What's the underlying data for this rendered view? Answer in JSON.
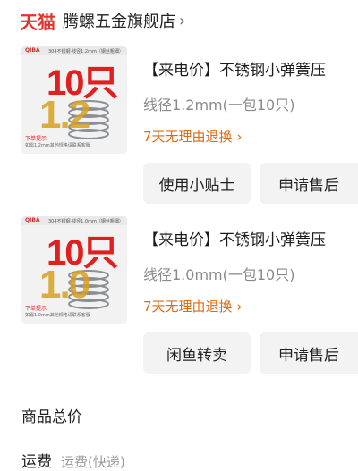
{
  "shop": {
    "logo": "天猫",
    "name": "腾螺五金旗舰店",
    "chevron": "›"
  },
  "orders": [
    {
      "thumb": {
        "brand": "QIBA",
        "spec": "304不锈钢·线径1.2mm（钢丝粗细）",
        "count": "10只",
        "size": "1.2",
        "tag": "下单提示",
        "tiny": "如需1.2mm其他规格请联系客服"
      },
      "title": "【来电价】不锈钢小弹簧压",
      "spec": "线径1.2mm(一包10只)",
      "returns": "7天无理由退换",
      "buttons": [
        "使用小贴士",
        "申请售后"
      ]
    },
    {
      "thumb": {
        "brand": "QIBA",
        "spec": "304不锈钢·线径1.0mm（钢丝粗细）",
        "count": "10只",
        "size": "1.0",
        "tag": "下单提示",
        "tiny": "如需1.0mm其他规格请联系客服"
      },
      "title": "【来电价】不锈钢小弹簧压",
      "spec": "线径1.0mm(一包10只)",
      "returns": "7天无理由退换",
      "buttons": [
        "闲鱼转卖",
        "申请售后"
      ]
    }
  ],
  "summary": {
    "total_label": "商品总价",
    "shipping_label": "运费",
    "shipping_sub": "运费(快递)"
  },
  "colors": {
    "tmall_red": "#e5322e",
    "returns_orange": "#e06a10",
    "button_bg": "#f3f3f3"
  }
}
